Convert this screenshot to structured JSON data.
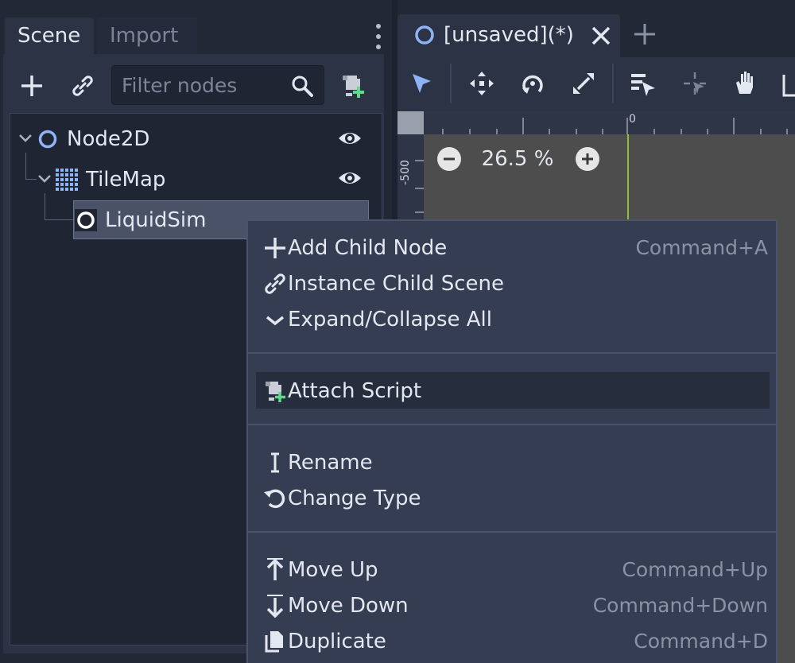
{
  "scene_dock": {
    "tabs": [
      {
        "label": "Scene",
        "active": true
      },
      {
        "label": "Import",
        "active": false
      }
    ],
    "filter": {
      "placeholder": "Filter nodes",
      "value": ""
    },
    "tree": [
      {
        "name": "Node2D",
        "icon": "node2d-icon",
        "visible": true
      },
      {
        "name": "TileMap",
        "icon": "tilemap-icon",
        "visible": true
      },
      {
        "name": "LiquidSim",
        "icon": "node-icon",
        "selected": true
      }
    ]
  },
  "viewport": {
    "scene_tab": {
      "title": "[unsaved](*)"
    },
    "zoom": "26.5 %",
    "ruler": {
      "x_zero": "0",
      "y_label": "-500"
    }
  },
  "context_menu": {
    "items": [
      {
        "label": "Add Child Node",
        "shortcut": "Command+A",
        "icon": "plus-icon"
      },
      {
        "label": "Instance Child Scene",
        "shortcut": "",
        "icon": "link-icon"
      },
      {
        "label": "Expand/Collapse All",
        "shortcut": "",
        "icon": "chevron-down-icon"
      },
      {
        "label": "Attach Script",
        "shortcut": "",
        "icon": "script-add-icon",
        "highlighted": true
      },
      {
        "label": "Rename",
        "shortcut": "",
        "icon": "rename-icon"
      },
      {
        "label": "Change Type",
        "shortcut": "",
        "icon": "rotate-icon"
      },
      {
        "label": "Move Up",
        "shortcut": "Command+Up",
        "icon": "arrow-up-icon"
      },
      {
        "label": "Move Down",
        "shortcut": "Command+Down",
        "icon": "arrow-down-icon"
      },
      {
        "label": "Duplicate",
        "shortcut": "Command+D",
        "icon": "duplicate-icon"
      }
    ]
  },
  "colors": {
    "accent": "#8eb4f5",
    "panel": "#2b3345",
    "menu_bg": "#343d51",
    "y_axis": "#8fbf3a"
  }
}
